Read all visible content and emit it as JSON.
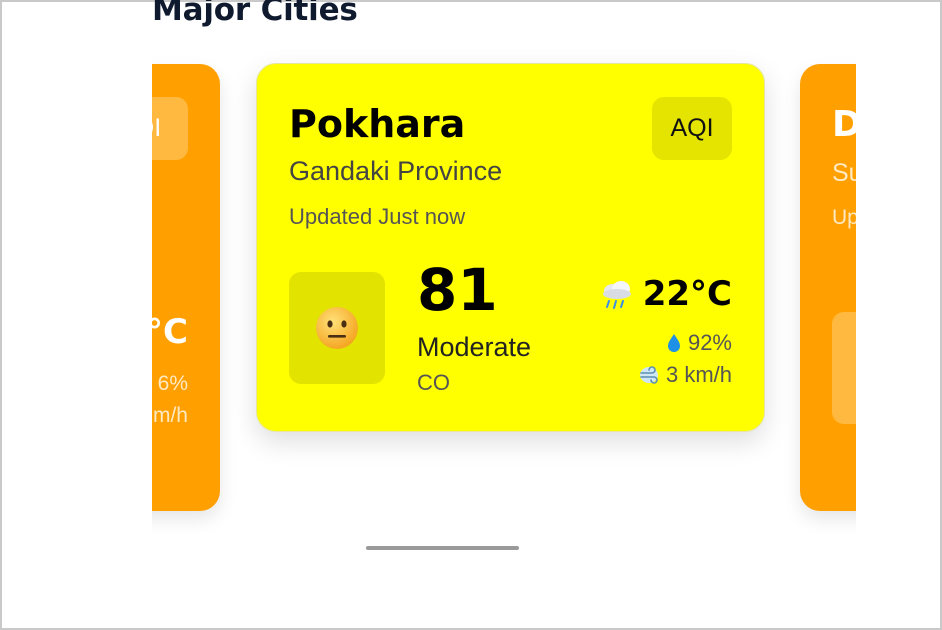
{
  "section": {
    "title": "Major Cities"
  },
  "cards": {
    "left": {
      "aqi_label": "QI",
      "temperature": "°C",
      "humidity": "6%",
      "wind": "m/h"
    },
    "main": {
      "city": "Pokhara",
      "province": "Gandaki Province",
      "updated": "Updated Just now",
      "aqi_label": "AQI",
      "aqi_value": "81",
      "aqi_level": "Moderate",
      "pollutant": "CO",
      "temperature": "22°C",
      "humidity": "92%",
      "wind": "3 km/h",
      "background_color": "#ffff00",
      "face_icon": "neutral-face-icon",
      "weather_icon": "rain-cloud-icon"
    },
    "right": {
      "city": "D",
      "province": "Su",
      "updated": "Up",
      "background_color": "#ffa000"
    }
  }
}
